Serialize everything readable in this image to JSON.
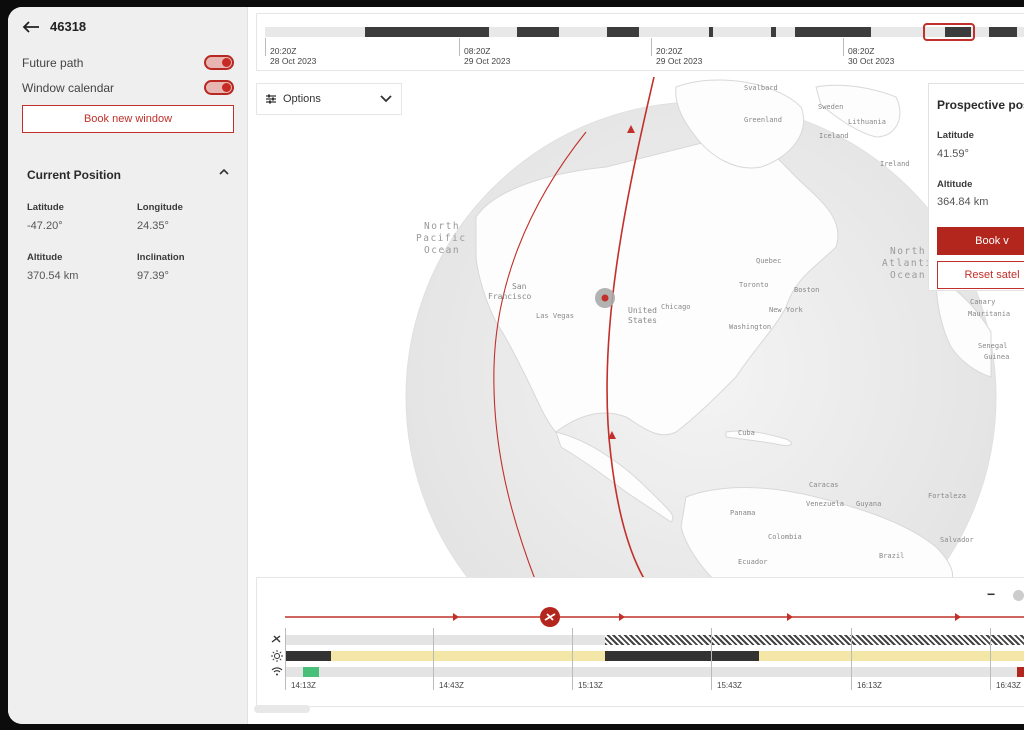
{
  "header": {
    "satellite_id": "46318"
  },
  "toggles": [
    {
      "label": "Future path",
      "on": true
    },
    {
      "label": "Window calendar",
      "on": true
    }
  ],
  "book_new_window": "Book new window",
  "current_position": {
    "title": "Current Position",
    "fields": [
      {
        "label": "Latitude",
        "value": "-47.20°"
      },
      {
        "label": "Longitude",
        "value": "24.35°"
      },
      {
        "label": "Altitude",
        "value": "370.54 km"
      },
      {
        "label": "Inclination",
        "value": "97.39°"
      }
    ]
  },
  "top_timeline": {
    "ticks": [
      {
        "time": "20:20Z",
        "date": "28 Oct 2023"
      },
      {
        "time": "08:20Z",
        "date": "29 Oct 2023"
      },
      {
        "time": "20:20Z",
        "date": "29 Oct 2023"
      },
      {
        "time": "08:20Z",
        "date": "30 Oct 2023"
      }
    ]
  },
  "options": {
    "label": "Options"
  },
  "map": {
    "labels": {
      "svalbard": "Svalbard",
      "sweden": "Sweden",
      "greenland": "Greenland",
      "lithuania": "Lithuania",
      "iceland": "Iceland",
      "ireland": "Ireland",
      "north_pacific": [
        "North",
        "Pacific",
        "Ocean"
      ],
      "north_atlantic": [
        "North",
        "Atlantic",
        "Ocean"
      ],
      "quebec": "Quebec",
      "toronto": "Toronto",
      "boston": "Boston",
      "new_york": "New York",
      "chicago": "Chicago",
      "washington": "Washington",
      "united_states": [
        "United",
        "States"
      ],
      "san_francisco": [
        "San",
        "Francisco"
      ],
      "las_vegas": "Las Vegas",
      "cuba": "Cuba",
      "caracas": "Caracas",
      "venezuela": "Venezuela",
      "guyana": "Guyana",
      "panama": "Panama",
      "colombia": "Colombia",
      "ecuador": "Ecuador",
      "brazil": "Brazil",
      "fortaleza": "Fortaleza",
      "salvador": "Salvador",
      "canary": "Canary",
      "mauritania": "Mauritania",
      "senegal": "Senegal",
      "guinea": "Guinea"
    }
  },
  "prospective": {
    "title": "Prospective pos",
    "latitude_label": "Latitude",
    "latitude_value": "41.59°",
    "altitude_label": "Altitude",
    "altitude_value": "364.84 km",
    "book_label": "Book v",
    "reset_label": "Reset satel"
  },
  "bottom_timeline": {
    "ticks": [
      "14:13Z",
      "14:43Z",
      "15:13Z",
      "15:43Z",
      "16:13Z",
      "16:43Z"
    ],
    "zoom_out": "−"
  },
  "colors": {
    "accent": "#b3261e",
    "dark": "#333333",
    "sun": "#f4e6a6",
    "contact": "#48c07a"
  }
}
